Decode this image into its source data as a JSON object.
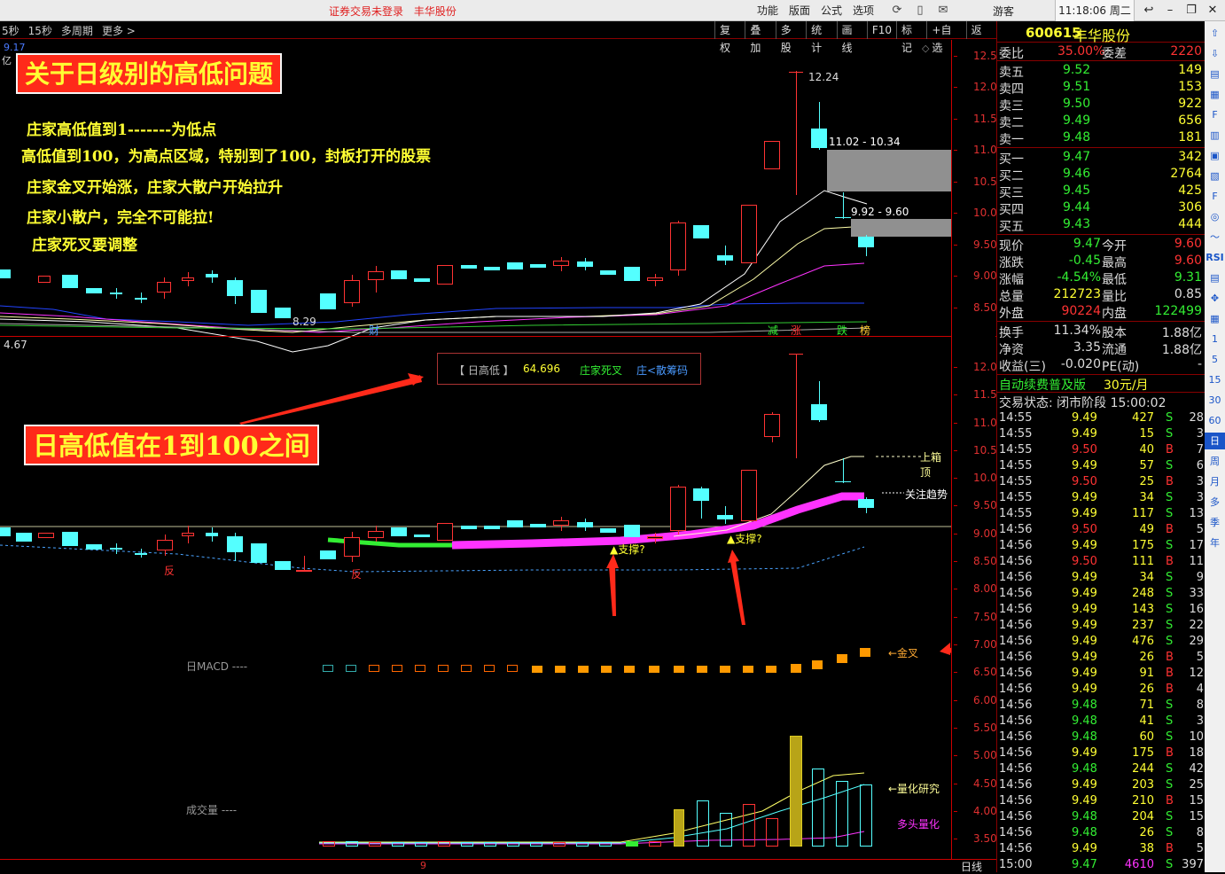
{
  "topbar": {
    "notice": [
      "证券交易未登录",
      "丰华股份"
    ],
    "menu": [
      "功能",
      "版面",
      "公式",
      "选项"
    ],
    "guest": "游客",
    "clock": "11:18:06 周二"
  },
  "toolbar": {
    "periods": [
      "5秒",
      "15秒",
      "多周期",
      "更多 >"
    ],
    "tools": [
      "复权",
      "叠加",
      "多股",
      "统计",
      "画线",
      "F10",
      "标记",
      "+自选",
      "返回"
    ]
  },
  "main_chart": {
    "corner_top": "9.17",
    "corner_top2": "亿",
    "price_axis": [
      "12.50",
      "12.00",
      "11.50",
      "11.00",
      "10.50",
      "10.00",
      "9.50",
      "9.00",
      "8.50"
    ],
    "high_label": "12.24",
    "low_label": "8.29",
    "range1": "11.02 - 10.34",
    "range2": "9.92 - 9.60",
    "event_tags": [
      "财",
      "减",
      "涨",
      "跌",
      "榜"
    ]
  },
  "annotations": {
    "title1": "关于日级别的高低问题",
    "lines": [
      "庄家高低值到1-------为低点",
      "高低值到100，为高点区域，特别到了100，封板打开的股票",
      "庄家金叉开始涨，庄家大散户开始拉升",
      "庄家小散户，完全不可能拉!",
      "庄家死叉要调整"
    ],
    "title2": "日高低值在1到100之间"
  },
  "indicator": {
    "corner": "4.67",
    "legend_name": "【 日高低 】",
    "legend_value": "64.696",
    "legend_dead": "庄家死叉",
    "legend_chip": "庄<散筹码",
    "axis": [
      "12.00",
      "11.50",
      "11.00",
      "10.50",
      "10.00",
      "9.50",
      "9.00",
      "8.50",
      "8.00",
      "7.50",
      "7.00",
      "6.50",
      "6.00",
      "5.50",
      "5.00",
      "4.50",
      "4.00",
      "3.50"
    ],
    "upper_box": "上箱顶",
    "trend": "关注趋势",
    "support": "▲支撑?",
    "rev": "反",
    "macd_label": "日MACD ----",
    "golden": "←金叉",
    "vol_label": "成交量 ----",
    "quant": "←量化研究",
    "bull": "多头量化",
    "bottom_tick": "9",
    "period_label": "日线"
  },
  "quote": {
    "code": "600615",
    "name": "丰华股份",
    "wb_label": "委比",
    "wb": "35.00%",
    "wc_label": "委差",
    "wc": "2220",
    "sells": [
      {
        "label": "卖五",
        "price": "9.52",
        "vol": "149"
      },
      {
        "label": "卖四",
        "price": "9.51",
        "vol": "153"
      },
      {
        "label": "卖三",
        "price": "9.50",
        "vol": "922"
      },
      {
        "label": "卖二",
        "price": "9.49",
        "vol": "656"
      },
      {
        "label": "卖一",
        "price": "9.48",
        "vol": "181"
      }
    ],
    "buys": [
      {
        "label": "买一",
        "price": "9.47",
        "vol": "342"
      },
      {
        "label": "买二",
        "price": "9.46",
        "vol": "2764"
      },
      {
        "label": "买三",
        "price": "9.45",
        "vol": "425"
      },
      {
        "label": "买四",
        "price": "9.44",
        "vol": "306"
      },
      {
        "label": "买五",
        "price": "9.43",
        "vol": "444"
      }
    ],
    "stats": [
      {
        "l1": "现价",
        "v1": "9.47",
        "l2": "今开",
        "v2": "9.60"
      },
      {
        "l1": "涨跌",
        "v1": "-0.45",
        "l2": "最高",
        "v2": "9.60"
      },
      {
        "l1": "涨幅",
        "v1": "-4.54%",
        "l2": "最低",
        "v2": "9.31"
      },
      {
        "l1": "总量",
        "v1": "212723",
        "l2": "量比",
        "v2": "0.85"
      },
      {
        "l1": "外盘",
        "v1": "90224",
        "l2": "内盘",
        "v2": "122499"
      }
    ],
    "stats2": [
      {
        "l1": "换手",
        "v1": "11.34%",
        "l2": "股本",
        "v2": "1.88亿"
      },
      {
        "l1": "净资",
        "v1": "3.35",
        "l2": "流通",
        "v2": "1.88亿"
      },
      {
        "l1": "收益(三)",
        "v1": "-0.020",
        "l2": "PE(动)",
        "v2": "-"
      }
    ],
    "promo": "自动续费普及版",
    "promo_price": "30元/月",
    "status": "交易状态: 闭市阶段 15:00:02",
    "ticks": [
      [
        "14:55",
        "9.49",
        "427",
        "S",
        "28"
      ],
      [
        "14:55",
        "9.49",
        "15",
        "S",
        "3"
      ],
      [
        "14:55",
        "9.50",
        "40",
        "B",
        "7"
      ],
      [
        "14:55",
        "9.49",
        "57",
        "S",
        "6"
      ],
      [
        "14:55",
        "9.50",
        "25",
        "B",
        "3"
      ],
      [
        "14:55",
        "9.49",
        "34",
        "S",
        "3"
      ],
      [
        "14:55",
        "9.49",
        "117",
        "S",
        "13"
      ],
      [
        "14:56",
        "9.50",
        "49",
        "B",
        "5"
      ],
      [
        "14:56",
        "9.49",
        "175",
        "S",
        "17"
      ],
      [
        "14:56",
        "9.50",
        "111",
        "B",
        "11"
      ],
      [
        "14:56",
        "9.49",
        "34",
        "S",
        "9"
      ],
      [
        "14:56",
        "9.49",
        "248",
        "S",
        "33"
      ],
      [
        "14:56",
        "9.49",
        "143",
        "S",
        "16"
      ],
      [
        "14:56",
        "9.49",
        "237",
        "S",
        "22"
      ],
      [
        "14:56",
        "9.49",
        "476",
        "S",
        "29"
      ],
      [
        "14:56",
        "9.49",
        "26",
        "B",
        "5"
      ],
      [
        "14:56",
        "9.49",
        "91",
        "B",
        "12"
      ],
      [
        "14:56",
        "9.49",
        "26",
        "B",
        "4"
      ],
      [
        "14:56",
        "9.48",
        "71",
        "S",
        "8"
      ],
      [
        "14:56",
        "9.48",
        "41",
        "S",
        "3"
      ],
      [
        "14:56",
        "9.48",
        "60",
        "S",
        "10"
      ],
      [
        "14:56",
        "9.49",
        "175",
        "B",
        "18"
      ],
      [
        "14:56",
        "9.48",
        "244",
        "S",
        "42"
      ],
      [
        "14:56",
        "9.49",
        "203",
        "S",
        "25"
      ],
      [
        "14:56",
        "9.49",
        "210",
        "B",
        "15"
      ],
      [
        "14:56",
        "9.48",
        "204",
        "S",
        "15"
      ],
      [
        "14:56",
        "9.48",
        "26",
        "S",
        "8"
      ],
      [
        "14:56",
        "9.49",
        "38",
        "B",
        "5"
      ],
      [
        "15:00",
        "9.47",
        "4610",
        "S",
        "397"
      ]
    ]
  },
  "right_toolbar": [
    "RSI",
    "1",
    "5",
    "15",
    "30",
    "60",
    "日",
    "周",
    "月",
    "多",
    "季",
    "年"
  ]
}
